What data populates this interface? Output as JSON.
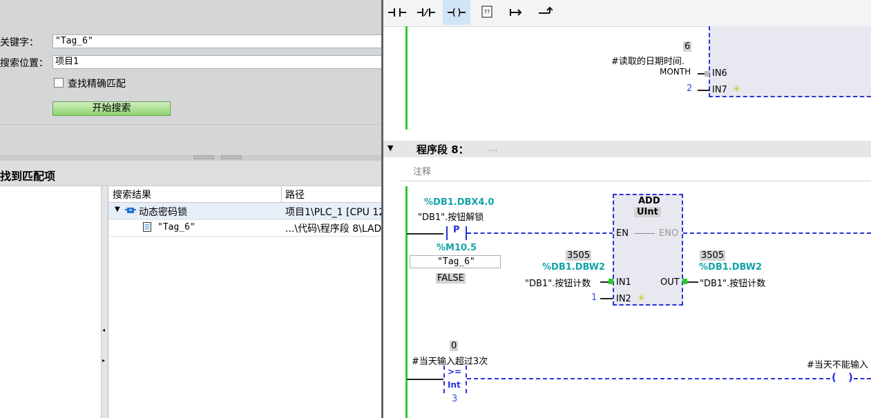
{
  "search": {
    "keyword_label": "关键字：",
    "keyword_value": "\"Tag_6\"",
    "location_label": "搜索位置：",
    "location_value": "项目1",
    "exact_match_label": "查找精确匹配",
    "start_button": "开始搜索"
  },
  "results": {
    "title": "找到匹配项",
    "columns": [
      "搜索结果",
      "路径"
    ],
    "rows": [
      {
        "result": "动态密码锁",
        "path": "项目1\\PLC_1 [CPU 12"
      },
      {
        "result": "\"Tag_6\"",
        "path": "...\\代码\\程序段 8\\LAD/"
      }
    ]
  },
  "toolbar": {
    "icons": [
      "no-contact-icon",
      "nc-contact-icon",
      "coil-icon",
      "empty-box-icon",
      "open-branch-icon",
      "close-branch-icon"
    ],
    "glyphs": [
      "⊣⊢",
      "⊣/⊢",
      "–( )–",
      "??",
      "↦",
      "⤴"
    ]
  },
  "upper": {
    "value_6": "6",
    "var_comment": "#读取的日期时间.",
    "month_label": "MONTH",
    "in6": "IN6",
    "in7": "IN7",
    "in7_value": "2"
  },
  "segment": {
    "title": "程序段 8：",
    "title_extra": "....",
    "comment": "注释"
  },
  "contact": {
    "address": "%DB1.DBX4.0",
    "name": "\"DB1\".按钮解锁",
    "type_letter": "P",
    "edge_address": "%M10.5",
    "edge_tag": "\"Tag_6\"",
    "edge_state": "FALSE"
  },
  "add_block": {
    "name": "ADD",
    "dtype": "UInt",
    "en": "EN",
    "eno": "ENO",
    "in1": "IN1",
    "in2": "IN2",
    "out": "OUT",
    "in1_value": "3505",
    "in1_address": "%DB1.DBW2",
    "in1_name": "\"DB1\".按钮计数",
    "in2_value": "1",
    "out_value": "3505",
    "out_address": "%DB1.DBW2",
    "out_name": "\"DB1\".按钮计数"
  },
  "compare": {
    "value": "0",
    "var": "#当天输入超过3次",
    "op": ">=",
    "dtype": "Int",
    "operand": "3",
    "coil_var": "#当天不能输入"
  },
  "colors": {
    "rail_green": "#2ecb2e",
    "wire_blue": "#2532d8",
    "address_teal": "#13a3a8",
    "block_fill": "#e8e8f0",
    "search_button": "#8fd46e"
  }
}
